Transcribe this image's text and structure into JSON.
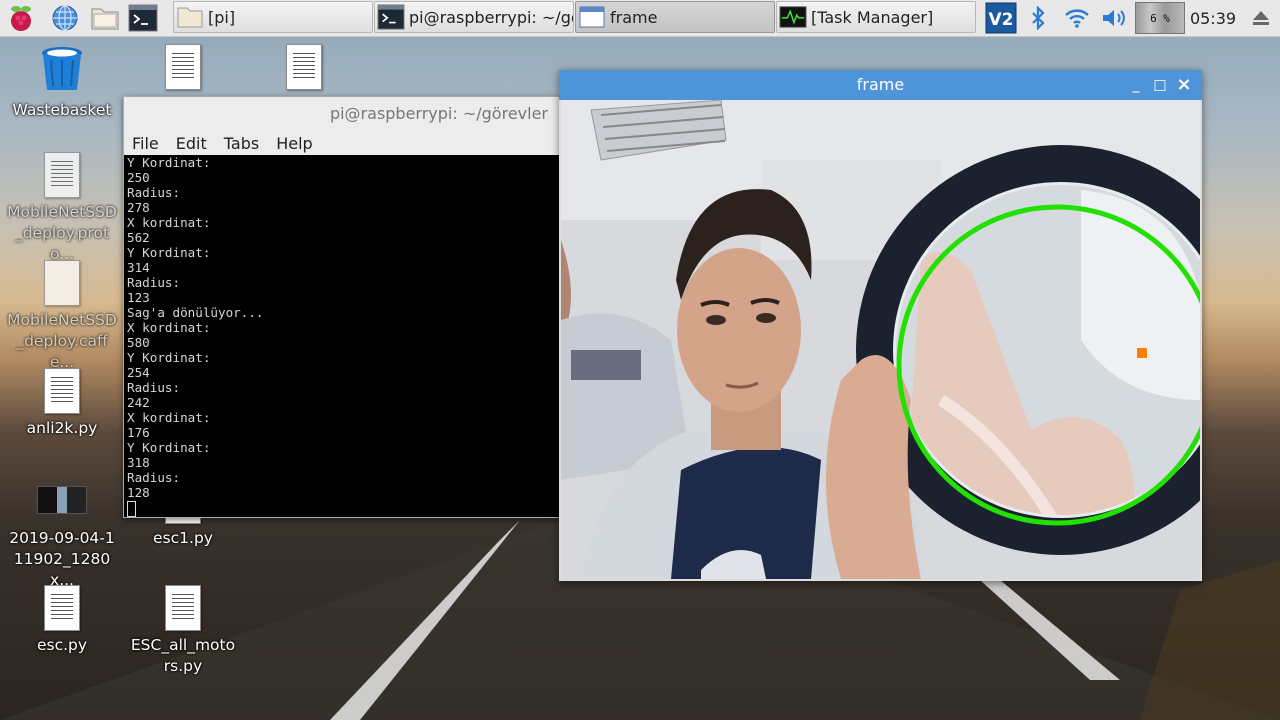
{
  "taskbar": {
    "tasks": [
      {
        "label": "[pi]"
      },
      {
        "label": "pi@raspberrypi: ~/gö..."
      },
      {
        "label": "frame"
      },
      {
        "label": "[Task Manager]"
      }
    ],
    "cpu_percent": "6 %",
    "clock": "05:39"
  },
  "desktop": {
    "icons": [
      {
        "label": "Wastebasket"
      },
      {
        "label": "MobileNetSSD_deploy.proto..."
      },
      {
        "label": "MobileNetSSD_deploy.caffe..."
      },
      {
        "label": "anli2k.py"
      },
      {
        "label": "2019-09-04-111902_1280x..."
      },
      {
        "label": "esc1.py"
      },
      {
        "label": "esc.py"
      },
      {
        "label": "ESC_all_motors.py"
      }
    ]
  },
  "terminal": {
    "title": "pi@raspberrypi: ~/görevler",
    "menu": [
      "File",
      "Edit",
      "Tabs",
      "Help"
    ],
    "lines": [
      "Y Kordinat:",
      "250",
      "Radius:",
      "278",
      "X kordinat:",
      "562",
      "Y Kordinat:",
      "314",
      "Radius:",
      "123",
      "Sag'a dönülüyor...",
      "X kordinat:",
      "580",
      "Y Kordinat:",
      "254",
      "Radius:",
      "242",
      "X kordinat:",
      "176",
      "Y Kordinat:",
      "318",
      "Radius:",
      "128"
    ]
  },
  "frame_window": {
    "title": "frame",
    "minimize": "_",
    "maximize": "□",
    "close": "×"
  },
  "colors": {
    "accent": "#4d94d8",
    "detection_circle": "#22e000",
    "center_marker": "#ff7f00"
  }
}
